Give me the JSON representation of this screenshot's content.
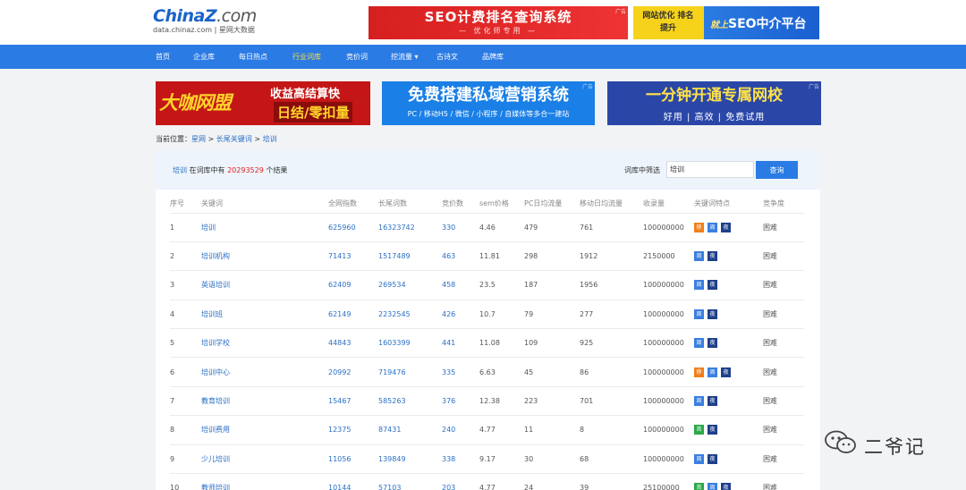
{
  "header": {
    "logo_text": "China",
    "logo_z": "Z",
    "logo_com": ".com",
    "logo_sub": "data.chinaz.com | 星网大数据",
    "ad_seo": {
      "title": "SEO计费排名查询系统",
      "sub": "— 优化师专用 —",
      "tag": "广告"
    },
    "ad_mid": {
      "left": "网站优化 排名提升",
      "right_pre": "就上",
      "right": "SEO中介平台"
    }
  },
  "nav": {
    "items": [
      {
        "label": "首页",
        "active": false
      },
      {
        "label": "企业库",
        "active": false
      },
      {
        "label": "每日热点",
        "active": false
      },
      {
        "label": "行业词库",
        "active": true
      },
      {
        "label": "竞价词",
        "active": false
      },
      {
        "label": "挖流量 ▾",
        "active": false
      },
      {
        "label": "古诗文",
        "active": false
      },
      {
        "label": "品牌库",
        "active": false
      }
    ]
  },
  "banners": {
    "b1": {
      "big": "大咖网盟",
      "r1": "收益高结算快",
      "r2": "日结/零扣量"
    },
    "b2": {
      "t1": "免费搭建私域营销系统",
      "t2": "PC / 移动H5 / 微信 / 小程序 / 自媒体等多合一建站"
    },
    "b3": {
      "t1": "一分钟开通专属网校",
      "t2": "好用 | 高效 | 免费试用"
    },
    "ad_tag": "广告"
  },
  "breadcrumb": {
    "prefix": "当前位置：",
    "items": [
      "星网",
      "长尾关键词",
      "培训"
    ],
    "sep": " > "
  },
  "summary": {
    "keyword": "培训",
    "middle": " 在词库中有 ",
    "count": "20293529",
    "suffix": " 个结果"
  },
  "filter": {
    "label": "词库中筛选",
    "value": "培训",
    "button": "查询"
  },
  "table": {
    "headers": [
      "序号",
      "关键词",
      "全网指数",
      "长尾词数",
      "竞价数",
      "sem价格",
      "PC日均流量",
      "移动日均流量",
      "收录量",
      "关键词特点",
      "竞争度"
    ],
    "rows": [
      {
        "no": "1",
        "kw": "培训",
        "idx": "625960",
        "tail": "16323742",
        "bid": "330",
        "sem": "4.46",
        "pc": "479",
        "mob": "761",
        "inc": "100000000",
        "tags": [
          "移",
          "周",
          "夜"
        ],
        "comp": "困难"
      },
      {
        "no": "2",
        "kw": "培训机构",
        "idx": "71413",
        "tail": "1517489",
        "bid": "463",
        "sem": "11.81",
        "pc": "298",
        "mob": "1912",
        "inc": "2150000",
        "tags": [
          "周",
          "夜"
        ],
        "comp": "困难"
      },
      {
        "no": "3",
        "kw": "英语培训",
        "idx": "62409",
        "tail": "269534",
        "bid": "458",
        "sem": "23.5",
        "pc": "187",
        "mob": "1956",
        "inc": "100000000",
        "tags": [
          "周",
          "夜"
        ],
        "comp": "困难"
      },
      {
        "no": "4",
        "kw": "培训班",
        "idx": "62149",
        "tail": "2232545",
        "bid": "426",
        "sem": "10.7",
        "pc": "79",
        "mob": "277",
        "inc": "100000000",
        "tags": [
          "周",
          "夜"
        ],
        "comp": "困难"
      },
      {
        "no": "5",
        "kw": "培训学校",
        "idx": "44843",
        "tail": "1603399",
        "bid": "441",
        "sem": "11.08",
        "pc": "109",
        "mob": "925",
        "inc": "100000000",
        "tags": [
          "周",
          "夜"
        ],
        "comp": "困难"
      },
      {
        "no": "6",
        "kw": "培训中心",
        "idx": "20992",
        "tail": "719476",
        "bid": "335",
        "sem": "6.63",
        "pc": "45",
        "mob": "86",
        "inc": "100000000",
        "tags": [
          "移",
          "周",
          "夜"
        ],
        "comp": "困难"
      },
      {
        "no": "7",
        "kw": "教育培训",
        "idx": "15467",
        "tail": "585263",
        "bid": "376",
        "sem": "12.38",
        "pc": "223",
        "mob": "701",
        "inc": "100000000",
        "tags": [
          "周",
          "夜"
        ],
        "comp": "困难"
      },
      {
        "no": "8",
        "kw": "培训费用",
        "idx": "12375",
        "tail": "87431",
        "bid": "240",
        "sem": "4.77",
        "pc": "11",
        "mob": "8",
        "inc": "100000000",
        "tags": [
          "首",
          "夜"
        ],
        "comp": "困难"
      },
      {
        "no": "9",
        "kw": "少儿培训",
        "idx": "11056",
        "tail": "139849",
        "bid": "338",
        "sem": "9.17",
        "pc": "30",
        "mob": "68",
        "inc": "100000000",
        "tags": [
          "周",
          "夜"
        ],
        "comp": "困难"
      },
      {
        "no": "10",
        "kw": "教师培训",
        "idx": "10144",
        "tail": "57103",
        "bid": "203",
        "sem": "4.77",
        "pc": "24",
        "mob": "39",
        "inc": "25100000",
        "tags": [
          "首",
          "周",
          "夜"
        ],
        "comp": "困难"
      }
    ]
  },
  "tag_colors": {
    "移": "#f07f1e",
    "周": "#3a7fe0",
    "夜": "#1e3f8a",
    "首": "#2aa84a"
  },
  "watermark": {
    "name": "二爷记"
  }
}
